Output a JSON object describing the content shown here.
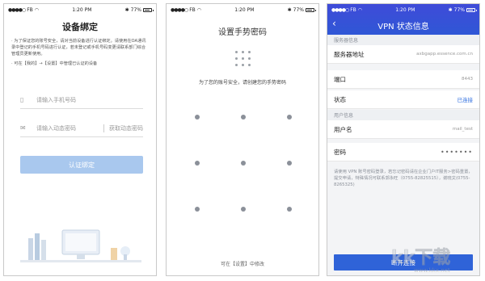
{
  "status": {
    "carrier": "FB",
    "time": "1:20 PM",
    "battery": "77%"
  },
  "screen1": {
    "title": "设备绑定",
    "notice_1": "· 为了保证您的账号安全，请对当前设备进行认证绑定。请使用在OA通讯录中登记的手机号码进行认证，若未登记或手机号码变更请联系部门综合管理员更新使用。",
    "notice_2": "· 可在【我的】→【设置】中管理已认证的设备",
    "phone_placeholder": "请输入手机号码",
    "code_placeholder": "请输入动态密码",
    "get_code": "获取动态密码",
    "submit": "认证绑定"
  },
  "screen2": {
    "title": "设置手势密码",
    "hint": "为了您的账号安全，请创建您的手势密码",
    "footer": "可在【设置】中修改"
  },
  "screen3": {
    "title": "VPN 状态信息",
    "server_section": "服务器信息",
    "server_label": "服务器地址",
    "server_value": "axbgapp.essence.com.cn",
    "port_label": "端口",
    "port_value": "8443",
    "state_label": "状态",
    "state_value": "已连接",
    "user_section": "用户信息",
    "username_label": "用户名",
    "username_value": "mail_test",
    "password_label": "密码",
    "password_value": "•••••••",
    "notice": "请使用 VPN 账号密码登录，若忘记密码请在企业门户IT服务>密码重置，提交申请，特殊情况可联系郭永旺（0755-82825515），谢晓文(0755-8265325)",
    "disconnect": "断开连接"
  },
  "colors": {
    "accent": "#2f63d8",
    "header": "#3f4bd8",
    "disabled_button": "#a9c8ee"
  }
}
